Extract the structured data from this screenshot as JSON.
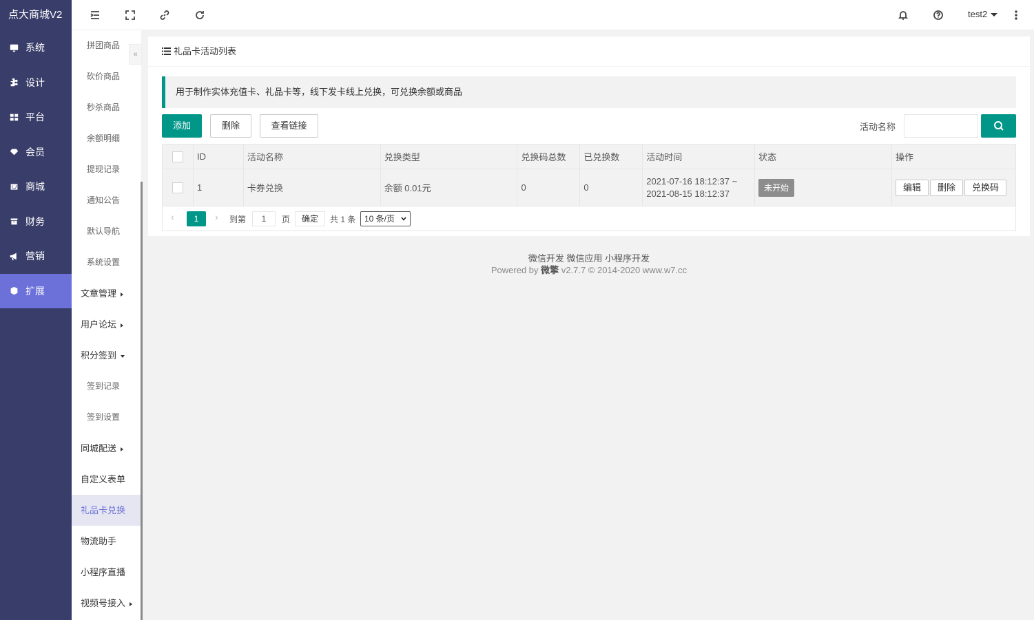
{
  "brand": "点大商城V2",
  "main_menu": [
    {
      "label": "系统",
      "icon": "monitor-icon"
    },
    {
      "label": "设计",
      "icon": "puzzle-icon"
    },
    {
      "label": "平台",
      "icon": "grid-icon"
    },
    {
      "label": "会员",
      "icon": "diamond-icon"
    },
    {
      "label": "商城",
      "icon": "store-icon"
    },
    {
      "label": "财务",
      "icon": "wallet-icon"
    },
    {
      "label": "营销",
      "icon": "megaphone-icon"
    },
    {
      "label": "扩展",
      "icon": "cube-icon",
      "active": true
    }
  ],
  "sub_menu": {
    "items_top": [
      "拼团商品",
      "砍价商品",
      "秒杀商品",
      "余额明细",
      "提现记录",
      "通知公告",
      "默认导航",
      "系统设置"
    ],
    "article": "文章管理",
    "forum": "用户论坛",
    "signin": "积分签到",
    "signin_children": [
      "签到记录",
      "签到设置"
    ],
    "delivery": "同城配送",
    "custom_form": "自定义表单",
    "giftcard": "礼品卡兑换",
    "logistics": "物流助手",
    "miniapp_live": "小程序直播",
    "channels": "视频号接入"
  },
  "topbar": {
    "username": "test2"
  },
  "card": {
    "title": "礼品卡活动列表",
    "tip": "用于制作实体充值卡、礼品卡等，线下发卡线上兑换，可兑换余额或商品"
  },
  "toolbar": {
    "add": "添加",
    "delete": "删除",
    "view_link": "查看链接",
    "search_label": "活动名称",
    "search_value": ""
  },
  "table": {
    "headers": [
      "ID",
      "活动名称",
      "兑换类型",
      "兑换码总数",
      "已兑换数",
      "活动时间",
      "状态",
      "操作"
    ],
    "rows": [
      {
        "id": "1",
        "name": "卡券兑换",
        "type": "余额 0.01元",
        "total_codes": "0",
        "redeemed": "0",
        "time_start": "2021-07-16 18:12:37 ~",
        "time_end": "2021-08-15 18:12:37",
        "status": "未开始",
        "actions": [
          "编辑",
          "删除",
          "兑换码"
        ]
      }
    ]
  },
  "pager": {
    "current": "1",
    "goto_label": "到第",
    "goto_value": "1",
    "page_unit": "页",
    "confirm": "确定",
    "total": "共 1 条",
    "page_size": "10 条/页"
  },
  "footer": {
    "line1": "微信开发 微信应用 小程序开发",
    "powered": "Powered by",
    "brand": "微擎",
    "rest": "v2.7.7 © 2014-2020 www.w7.cc"
  },
  "colors": {
    "sidebar": "#393d6a",
    "sidebar_active": "#6b71d8",
    "primary": "#009688"
  }
}
